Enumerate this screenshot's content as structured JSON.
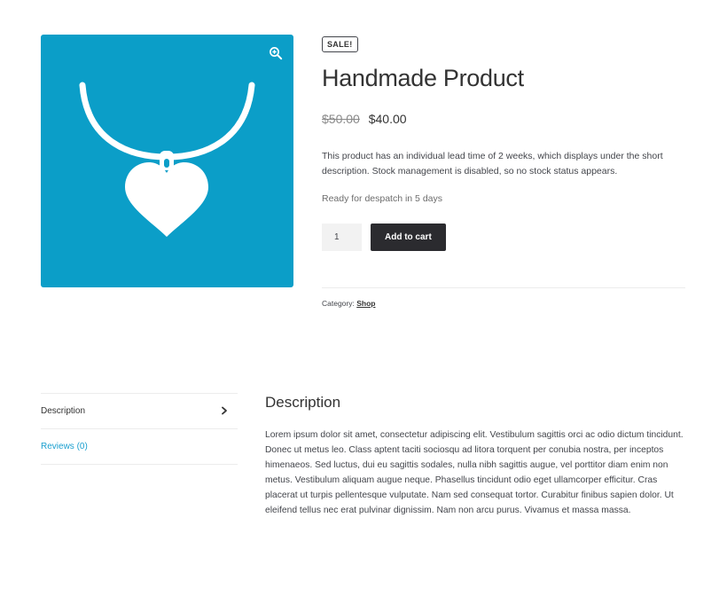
{
  "product": {
    "sale_badge": "SALE!",
    "title": "Handmade Product",
    "price_old": "$50.00",
    "price_new": "$40.00",
    "short_description": "This product has an individual lead time of 2 weeks, which displays under the short description. Stock management is disabled, so no stock status appears.",
    "stock_note": "Ready for despatch in 5 days",
    "quantity": "1",
    "add_to_cart_label": "Add to cart",
    "category_label": "Category:",
    "category_link": "Shop"
  },
  "image": {
    "background_color": "#0b9ec8",
    "icon": "heart-necklace-icon",
    "zoom_icon": "zoom-in-icon"
  },
  "tabs": [
    {
      "label": "Description",
      "active": true
    },
    {
      "label": "Reviews (0)",
      "active": false
    }
  ],
  "description_panel": {
    "heading": "Description",
    "body": "Lorem ipsum dolor sit amet, consectetur adipiscing elit. Vestibulum sagittis orci ac odio dictum tincidunt. Donec ut metus leo. Class aptent taciti sociosqu ad litora torquent per conubia nostra, per inceptos himenaeos. Sed luctus, dui eu sagittis sodales, nulla nibh sagittis augue, vel porttitor diam enim non metus. Vestibulum aliquam augue neque. Phasellus tincidunt odio eget ullamcorper efficitur. Cras placerat ut turpis pellentesque vulputate. Nam sed consequat tortor. Curabitur finibus sapien dolor. Ut eleifend tellus nec erat pulvinar dignissim. Nam non arcu purus. Vivamus et massa massa."
  },
  "colors": {
    "accent_link": "#1a9fcf",
    "button_dark": "#2b2b2f"
  }
}
